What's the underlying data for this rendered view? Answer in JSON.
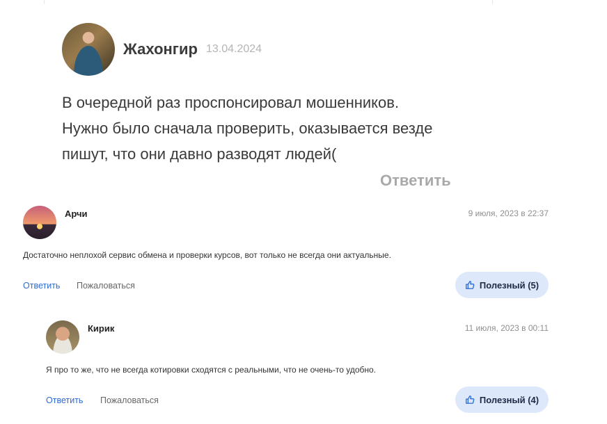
{
  "review": {
    "author": "Жахонгир",
    "date": "13.04.2024",
    "lines": [
      "В очередной раз проспонсировал мошенников.",
      "Нужно было сначала проверить, оказывается везде",
      "пишут, что они давно разводят людей("
    ],
    "reply_label": "Ответить"
  },
  "comments": [
    {
      "author": "Арчи",
      "date": "9 июля, 2023 в 22:37",
      "text": "Достаточно неплохой сервис обмена и проверки курсов, вот только не всегда они актуальные.",
      "reply_label": "Ответить",
      "report_label": "Пожаловаться",
      "useful_label": "Полезный (5)"
    },
    {
      "author": "Кирик",
      "date": "11 июля, 2023 в 00:11",
      "text": "Я про то же, что не всегда котировки сходятся с реальными, что не очень-то удобно.",
      "reply_label": "Ответить",
      "report_label": "Пожаловаться",
      "useful_label": "Полезный (4)"
    }
  ],
  "icons": {
    "useful": "thumbs-up-icon"
  },
  "colors": {
    "link": "#2d6ad1",
    "useful_bg": "#dde8fb",
    "muted": "#a9a9a9"
  }
}
